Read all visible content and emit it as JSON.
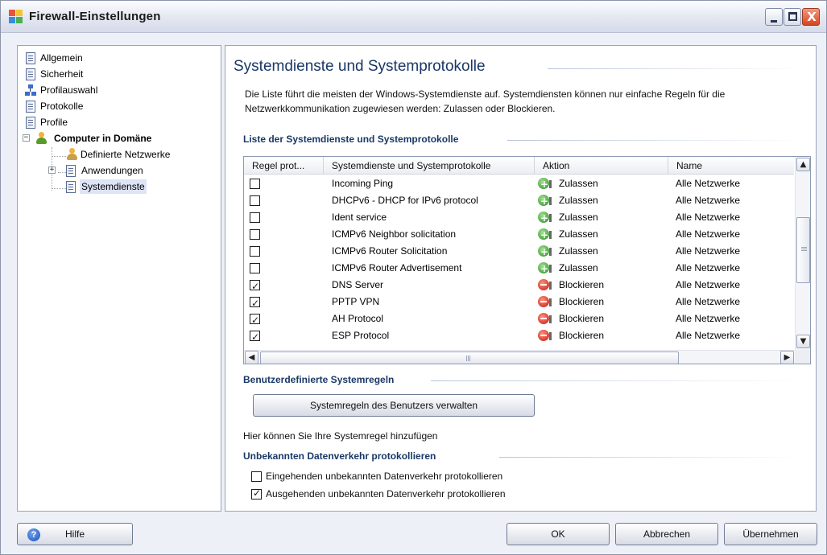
{
  "window": {
    "title": "Firewall-Einstellungen",
    "close_glyph": "X"
  },
  "sidebar": {
    "items": [
      {
        "label": "Allgemein",
        "icon": "document-icon"
      },
      {
        "label": "Sicherheit",
        "icon": "document-icon"
      },
      {
        "label": "Profilauswahl",
        "icon": "network-icon"
      },
      {
        "label": "Protokolle",
        "icon": "document-icon"
      },
      {
        "label": "Profile",
        "icon": "document-icon"
      },
      {
        "label": "Computer in Domäne",
        "icon": "user-icon",
        "expanded": true,
        "bold": true
      },
      {
        "label": "Definierte Netzwerke",
        "icon": "network-user-icon"
      },
      {
        "label": "Anwendungen",
        "icon": "document-icon",
        "expander": "+"
      },
      {
        "label": "Systemdienste",
        "icon": "document-icon",
        "selected": true
      }
    ]
  },
  "main": {
    "title": "Systemdienste und Systemprotokolle",
    "description": "Die Liste führt die meisten der Windows-Systemdienste auf. Systemdiensten können nur einfache Regeln für die Netzwerkkommunikation zugewiesen werden: Zulassen oder Blockieren.",
    "list_heading": "Liste der Systemdienste und Systemprotokolle",
    "columns": [
      "Regel prot...",
      "Systemdienste und Systemprotokolle",
      "Aktion",
      "Name"
    ],
    "rows": [
      {
        "checked": false,
        "service": "Incoming Ping",
        "action": "Zulassen",
        "action_type": "allow",
        "name": "Alle Netzwerke"
      },
      {
        "checked": false,
        "service": "DHCPv6 - DHCP for IPv6 protocol",
        "action": "Zulassen",
        "action_type": "allow",
        "name": "Alle Netzwerke"
      },
      {
        "checked": false,
        "service": "Ident service",
        "action": "Zulassen",
        "action_type": "allow",
        "name": "Alle Netzwerke"
      },
      {
        "checked": false,
        "service": "ICMPv6 Neighbor solicitation",
        "action": "Zulassen",
        "action_type": "allow",
        "name": "Alle Netzwerke"
      },
      {
        "checked": false,
        "service": "ICMPv6 Router Solicitation",
        "action": "Zulassen",
        "action_type": "allow",
        "name": "Alle Netzwerke"
      },
      {
        "checked": false,
        "service": "ICMPv6 Router Advertisement",
        "action": "Zulassen",
        "action_type": "allow",
        "name": "Alle Netzwerke"
      },
      {
        "checked": true,
        "service": "DNS Server",
        "action": "Blockieren",
        "action_type": "block",
        "name": "Alle Netzwerke"
      },
      {
        "checked": true,
        "service": "PPTP VPN",
        "action": "Blockieren",
        "action_type": "block",
        "name": "Alle Netzwerke"
      },
      {
        "checked": true,
        "service": "AH Protocol",
        "action": "Blockieren",
        "action_type": "block",
        "name": "Alle Netzwerke"
      },
      {
        "checked": true,
        "service": "ESP Protocol",
        "action": "Blockieren",
        "action_type": "block",
        "name": "Alle Netzwerke"
      }
    ],
    "custom_heading": "Benutzerdefinierte Systemregeln",
    "manage_button": "Systemregeln des Benutzers verwalten",
    "custom_hint": "Hier können Sie Ihre Systemregel hinzufügen",
    "unknown_heading": "Unbekannten Datenverkehr protokollieren",
    "options": [
      {
        "label": "Eingehenden unbekannten Datenverkehr protokollieren",
        "checked": false
      },
      {
        "label": "Ausgehenden unbekannten Datenverkehr protokollieren",
        "checked": true
      }
    ]
  },
  "footer": {
    "help": "Hilfe",
    "ok": "OK",
    "cancel": "Abbrechen",
    "apply": "Übernehmen"
  },
  "scrollbar": {
    "up": "▲",
    "down": "▼",
    "left": "◀",
    "right": "▶"
  },
  "colors": {
    "heading": "#1a3866",
    "allow": "#2e8b2a",
    "block": "#c21a12"
  }
}
